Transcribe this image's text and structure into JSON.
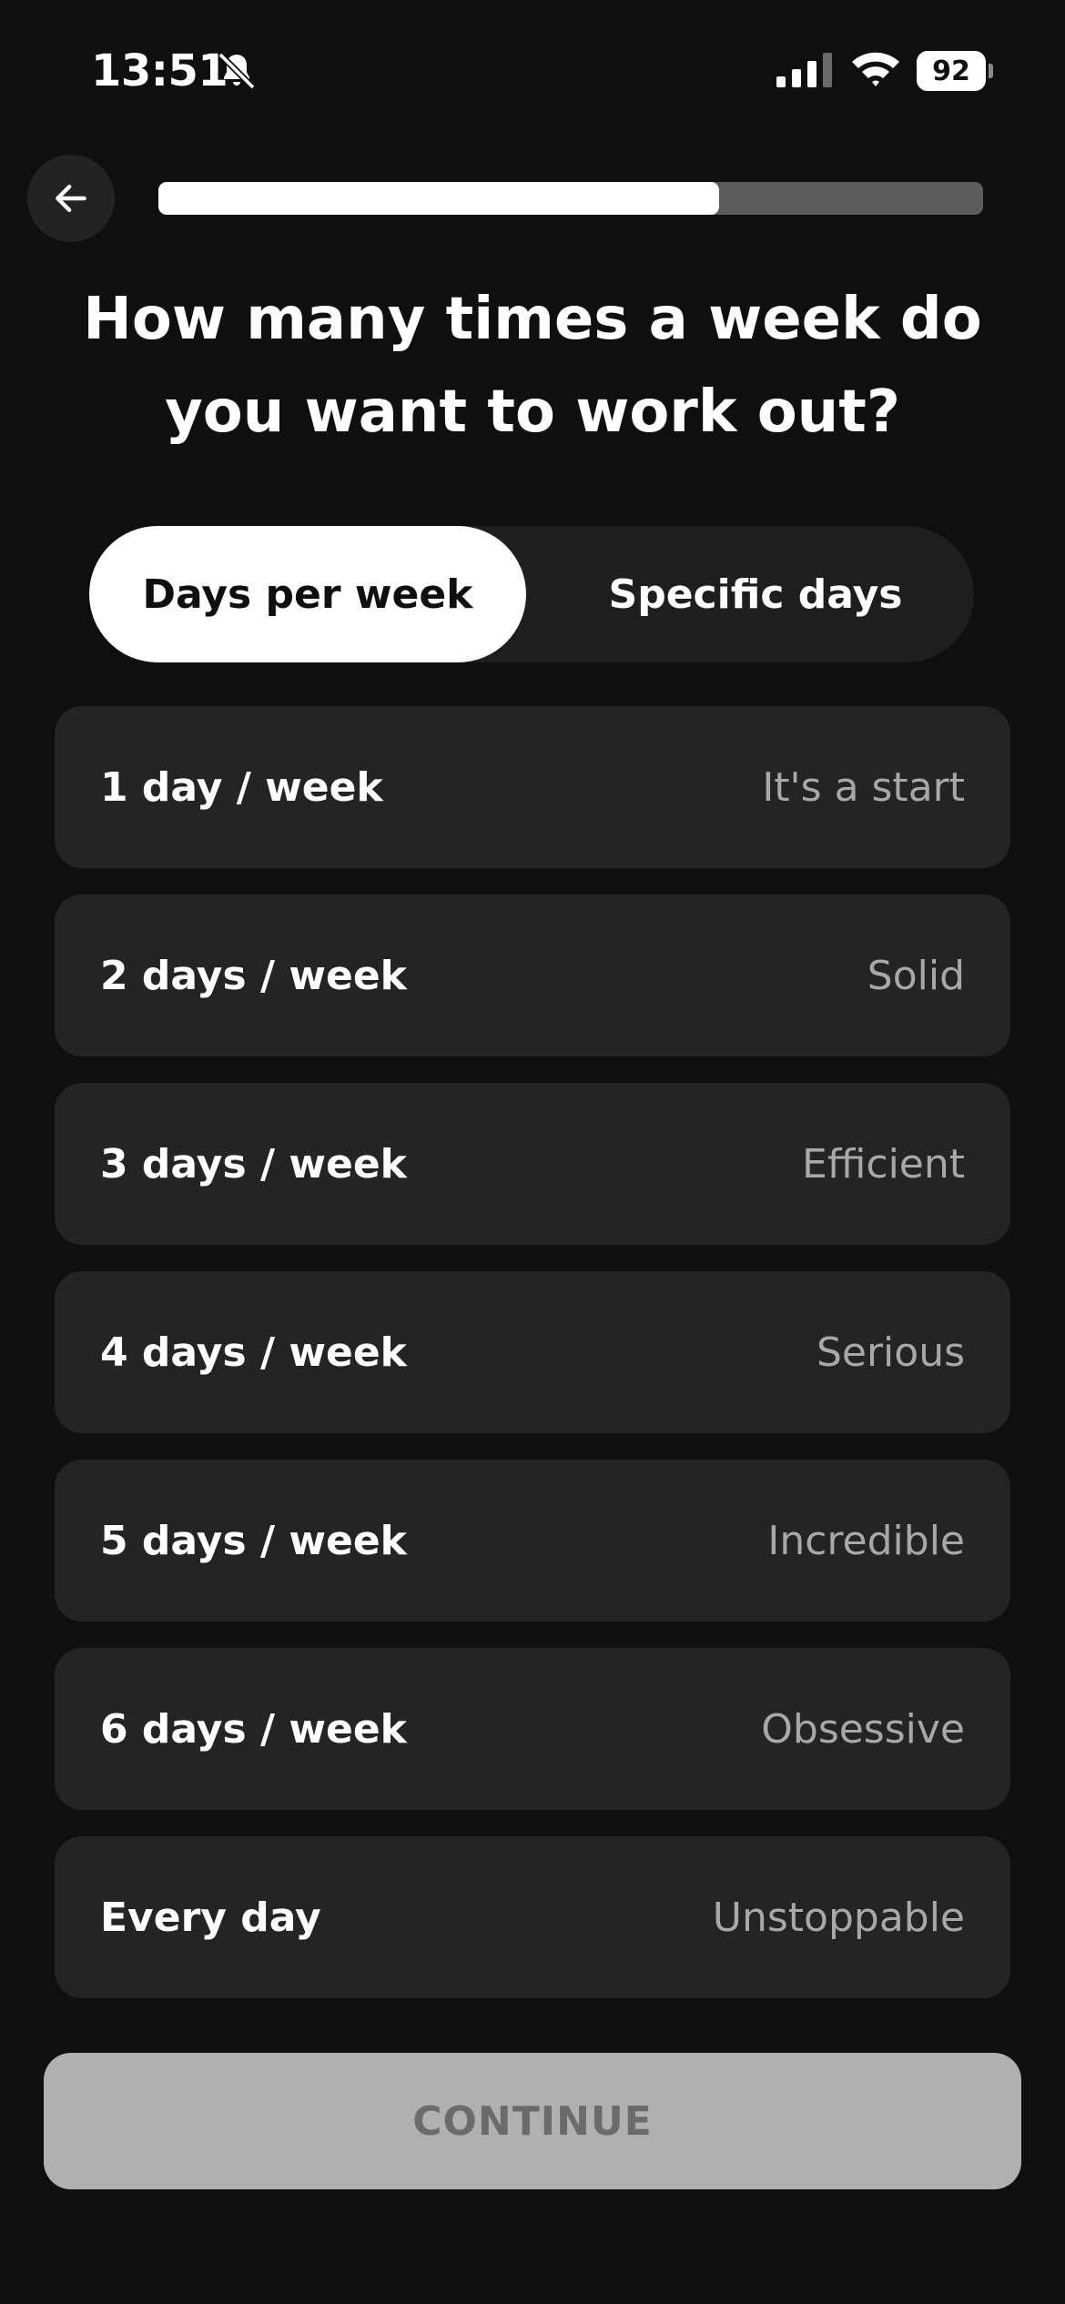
{
  "status_bar": {
    "time": "13:51",
    "battery": "92",
    "icons": [
      "bell-slash-icon",
      "cellular-signal-icon",
      "wifi-icon",
      "battery-icon"
    ]
  },
  "nav": {
    "back_icon": "arrow-left-icon",
    "progress_fraction": 0.68
  },
  "title": "How many times a week do you want to work out?",
  "segmented": {
    "options": [
      "Days per week",
      "Specific days"
    ],
    "selected": "Days per week"
  },
  "options": [
    {
      "label": "1 day / week",
      "desc": "It's a start"
    },
    {
      "label": "2 days / week",
      "desc": "Solid"
    },
    {
      "label": "3 days / week",
      "desc": "Efficient"
    },
    {
      "label": "4 days / week",
      "desc": "Serious"
    },
    {
      "label": "5 days / week",
      "desc": "Incredible"
    },
    {
      "label": "6 days / week",
      "desc": "Obsessive"
    },
    {
      "label": "Every day",
      "desc": "Unstoppable"
    }
  ],
  "continue_label": "CONTINUE",
  "colors": {
    "background": "#0f0f0f",
    "card": "#242424",
    "accent": "#ffffff",
    "muted_text": "#a8a8a8",
    "disabled_button": "#b0b0b0"
  }
}
